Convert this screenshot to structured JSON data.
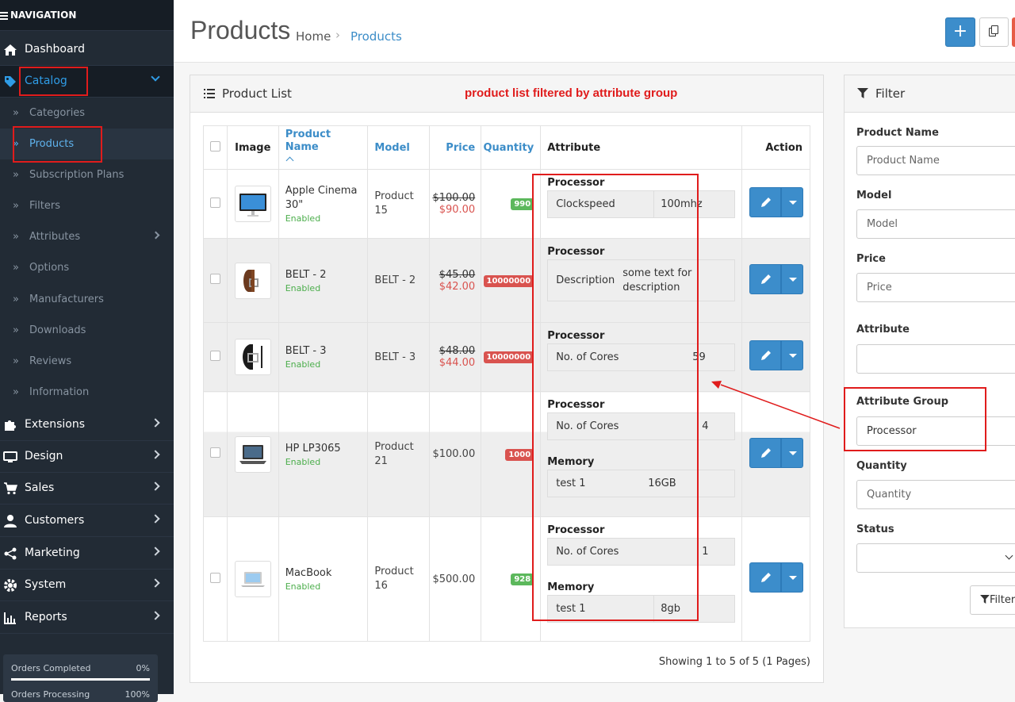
{
  "nav": {
    "title": "NAVIGATION",
    "dashboard": "Dashboard",
    "catalog": "Catalog",
    "catalog_items": [
      "Categories",
      "Products",
      "Subscription Plans",
      "Filters",
      "Attributes",
      "Options",
      "Manufacturers",
      "Downloads",
      "Reviews",
      "Information"
    ],
    "extensions": "Extensions",
    "design": "Design",
    "sales": "Sales",
    "customers": "Customers",
    "marketing": "Marketing",
    "system": "System",
    "reports": "Reports",
    "progress": {
      "orders_completed_label": "Orders Completed",
      "orders_completed_value": "0%",
      "orders_processing_label": "Orders Processing",
      "orders_processing_value": "100%"
    }
  },
  "header": {
    "title": "Products",
    "breadcrumb_home": "Home",
    "breadcrumb_sep": "›",
    "breadcrumb_current": "Products",
    "add_label": "+"
  },
  "list": {
    "title": "Product List",
    "annotation": "product list filtered by attribute group",
    "columns": {
      "image": "Image",
      "name": "Product Name",
      "model": "Model",
      "price": "Price",
      "quantity": "Quantity",
      "attribute": "Attribute",
      "action": "Action"
    },
    "products": [
      {
        "name": "Apple Cinema 30\"",
        "status": "Enabled",
        "model": "Product 15",
        "price_old": "$100.00",
        "price_new": "$90.00",
        "quantity": "990",
        "qty_color": "green"
      },
      {
        "name": "BELT - 2",
        "status": "Enabled",
        "model": "BELT - 2",
        "price_old": "$45.00",
        "price_new": "$42.00",
        "quantity": "10000000",
        "qty_color": "red"
      },
      {
        "name": "BELT - 3",
        "status": "Enabled",
        "model": "BELT - 3",
        "price_old": "$48.00",
        "price_new": "$44.00",
        "quantity": "10000000",
        "qty_color": "red"
      },
      {
        "name": "HP LP3065",
        "status": "Enabled",
        "model": "Product 21",
        "price": "$100.00",
        "quantity": "1000",
        "qty_color": "red"
      },
      {
        "name": "MacBook",
        "status": "Enabled",
        "model": "Product 16",
        "price": "$500.00",
        "quantity": "928",
        "qty_color": "green"
      }
    ],
    "attributes": {
      "p0": {
        "group": "Processor",
        "name": "Clockspeed",
        "value": "100mhz"
      },
      "p1": {
        "group": "Processor",
        "name": "Description",
        "value": "some text for description"
      },
      "p2": {
        "group": "Processor",
        "name": "No. of Cores",
        "value": "59"
      },
      "p3a": {
        "group": "Processor",
        "name": "No. of Cores",
        "value": "4"
      },
      "p3b": {
        "group": "Memory",
        "name": "test 1",
        "value": "16GB"
      },
      "p4a": {
        "group": "Processor",
        "name": "No. of Cores",
        "value": "1"
      },
      "p4b": {
        "group": "Memory",
        "name": "test 1",
        "value": "8gb"
      }
    },
    "showing": "Showing 1 to 5 of 5 (1 Pages)"
  },
  "filter": {
    "title": "Filter",
    "product_name_label": "Product Name",
    "product_name_placeholder": "Product Name",
    "model_label": "Model",
    "model_placeholder": "Model",
    "price_label": "Price",
    "price_placeholder": "Price",
    "attribute_label": "Attribute",
    "attribute_value": "",
    "attribute_group_label": "Attribute Group",
    "attribute_group_value": "Processor",
    "quantity_label": "Quantity",
    "quantity_placeholder": "Quantity",
    "status_label": "Status",
    "status_value": "",
    "filter_button": "Filter"
  },
  "colors": {
    "accent": "#3c8dcb",
    "annotation": "#e01c1c",
    "sidebar": "#222b35",
    "enabled": "#4cae4c"
  }
}
